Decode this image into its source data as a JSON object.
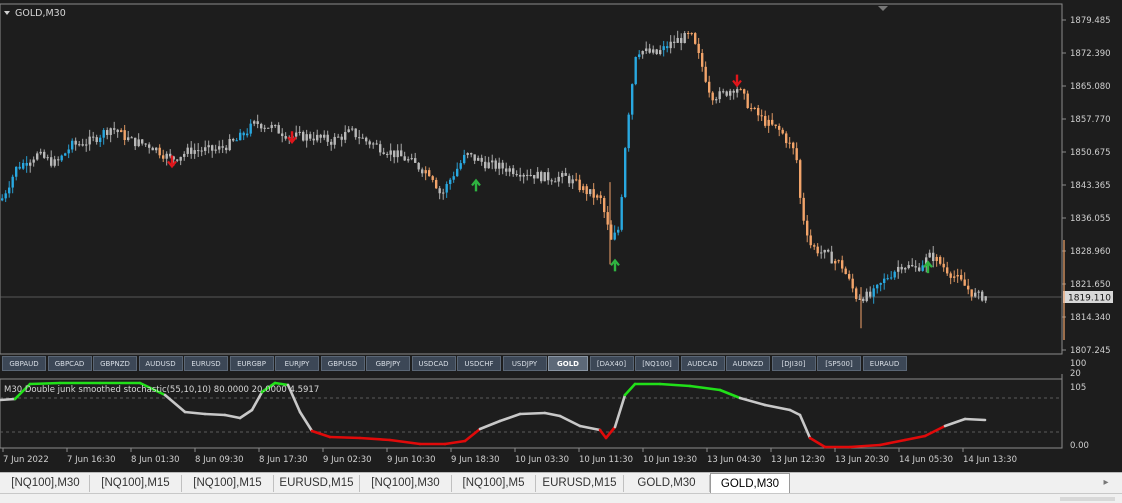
{
  "chart": {
    "symbol_label": "GOLD,M30",
    "current_price": "1819.110",
    "price_ticks": [
      "1879.485",
      "1872.390",
      "1865.080",
      "1857.770",
      "1850.675",
      "1843.365",
      "1836.055",
      "1828.960",
      "1821.650",
      "1814.340",
      "1807.245"
    ],
    "osc_scale_top": [
      "100",
      "20"
    ],
    "osc_ticks": [
      "105",
      "0.00"
    ],
    "indicator_label": "M30 Double junk smoothed stochastic(55,10,10) 80.0000 20.0000 4.5917",
    "time_labels": [
      "7 Jun 2022",
      "7 Jun 16:30",
      "8 Jun 01:30",
      "8 Jun 09:30",
      "8 Jun 17:30",
      "9 Jun 02:30",
      "9 Jun 10:30",
      "9 Jun 18:30",
      "10 Jun 03:30",
      "10 Jun 11:30",
      "10 Jun 19:30",
      "13 Jun 04:30",
      "13 Jun 12:30",
      "13 Jun 20:30",
      "14 Jun 05:30",
      "14 Jun 13:30"
    ],
    "colors": {
      "bg": "#1d1d1d",
      "bull": "#29a8e0",
      "bear": "#f2a46a",
      "neutral": "#b9b9b9",
      "arrow_down": "#e0161b",
      "arrow_up": "#2fb341",
      "osc_high": "#21e019",
      "osc_low": "#e00a0a",
      "osc_mid": "#c8c8c8"
    }
  },
  "chart_data": {
    "type": "candlestick",
    "title": "GOLD,M30",
    "ylim": [
      1807.245,
      1879.485
    ],
    "close_path": [
      [
        0,
        1840
      ],
      [
        15,
        1847
      ],
      [
        35,
        1850
      ],
      [
        55,
        1848
      ],
      [
        70,
        1852
      ],
      [
        90,
        1853
      ],
      [
        110,
        1856
      ],
      [
        130,
        1853
      ],
      [
        150,
        1852
      ],
      [
        170,
        1849
      ],
      [
        190,
        1851
      ],
      [
        215,
        1851
      ],
      [
        235,
        1853
      ],
      [
        255,
        1857
      ],
      [
        270,
        1856
      ],
      [
        290,
        1854
      ],
      [
        310,
        1854
      ],
      [
        330,
        1853
      ],
      [
        350,
        1855
      ],
      [
        365,
        1853
      ],
      [
        385,
        1851
      ],
      [
        405,
        1849
      ],
      [
        420,
        1847
      ],
      [
        430,
        1846
      ],
      [
        440,
        1841
      ],
      [
        450,
        1845
      ],
      [
        465,
        1850
      ],
      [
        485,
        1848
      ],
      [
        505,
        1847
      ],
      [
        525,
        1846
      ],
      [
        545,
        1845
      ],
      [
        565,
        1845
      ],
      [
        585,
        1842
      ],
      [
        600,
        1840
      ],
      [
        610,
        1831
      ],
      [
        618,
        1834
      ],
      [
        625,
        1855
      ],
      [
        635,
        1873
      ],
      [
        655,
        1872
      ],
      [
        675,
        1875
      ],
      [
        690,
        1876
      ],
      [
        700,
        1870
      ],
      [
        710,
        1863
      ],
      [
        720,
        1863
      ],
      [
        735,
        1865
      ],
      [
        750,
        1860
      ],
      [
        765,
        1857
      ],
      [
        780,
        1855
      ],
      [
        795,
        1850
      ],
      [
        800,
        1838
      ],
      [
        810,
        1830
      ],
      [
        825,
        1828
      ],
      [
        840,
        1826
      ],
      [
        855,
        1819
      ],
      [
        870,
        1819
      ],
      [
        885,
        1823
      ],
      [
        900,
        1826
      ],
      [
        915,
        1825
      ],
      [
        930,
        1828
      ],
      [
        945,
        1825
      ],
      [
        960,
        1822
      ],
      [
        975,
        1819
      ],
      [
        985,
        1819
      ]
    ],
    "signals": [
      {
        "type": "sell",
        "x": "7 Jun 2022 ~23:00"
      },
      {
        "type": "sell",
        "x": "8 Jun 17:30"
      },
      {
        "type": "buy",
        "x": "9 Jun 18:30"
      },
      {
        "type": "buy",
        "x": "10 Jun 11:30"
      },
      {
        "type": "sell",
        "x": "13 Jun 04:30"
      },
      {
        "type": "buy",
        "x": "14 Jun 05:30"
      }
    ],
    "oscillator": {
      "name": "Double junk smoothed stochastic",
      "levels": [
        80,
        20
      ],
      "range": [
        0,
        105
      ],
      "last_value": 4.5917
    }
  },
  "symbols": [
    {
      "label": "GBPAUD",
      "active": false
    },
    {
      "label": "GBPCAD",
      "active": false
    },
    {
      "label": "GBPNZD",
      "active": false
    },
    {
      "label": "AUDUSD",
      "active": false
    },
    {
      "label": "EURUSD",
      "active": false
    },
    {
      "label": "EURGBP",
      "active": false
    },
    {
      "label": "EURJPY",
      "active": false
    },
    {
      "label": "GBPUSD",
      "active": false
    },
    {
      "label": "GBPJPY",
      "active": false
    },
    {
      "label": "USDCAD",
      "active": false
    },
    {
      "label": "USDCHF",
      "active": false
    },
    {
      "label": "USDJPY",
      "active": false
    },
    {
      "label": "GOLD",
      "active": true
    },
    {
      "label": "[DAX40]",
      "active": false
    },
    {
      "label": "[NQ100]",
      "active": false
    },
    {
      "label": "AUDCAD",
      "active": false
    },
    {
      "label": "AUDNZD",
      "active": false
    },
    {
      "label": "[DJI30]",
      "active": false
    },
    {
      "label": "[SP500]",
      "active": false
    },
    {
      "label": "EURAUD",
      "active": false
    }
  ],
  "tabs": [
    {
      "label": "[NQ100],M30",
      "active": false
    },
    {
      "label": "[NQ100],M15",
      "active": false
    },
    {
      "label": "[NQ100],M15",
      "active": false
    },
    {
      "label": "EURUSD,M15",
      "active": false
    },
    {
      "label": "[NQ100],M30",
      "active": false
    },
    {
      "label": "[NQ100],M5",
      "active": false
    },
    {
      "label": "EURUSD,M15",
      "active": false
    },
    {
      "label": "GOLD,M30",
      "active": false
    },
    {
      "label": "GOLD,M30",
      "active": true
    }
  ]
}
